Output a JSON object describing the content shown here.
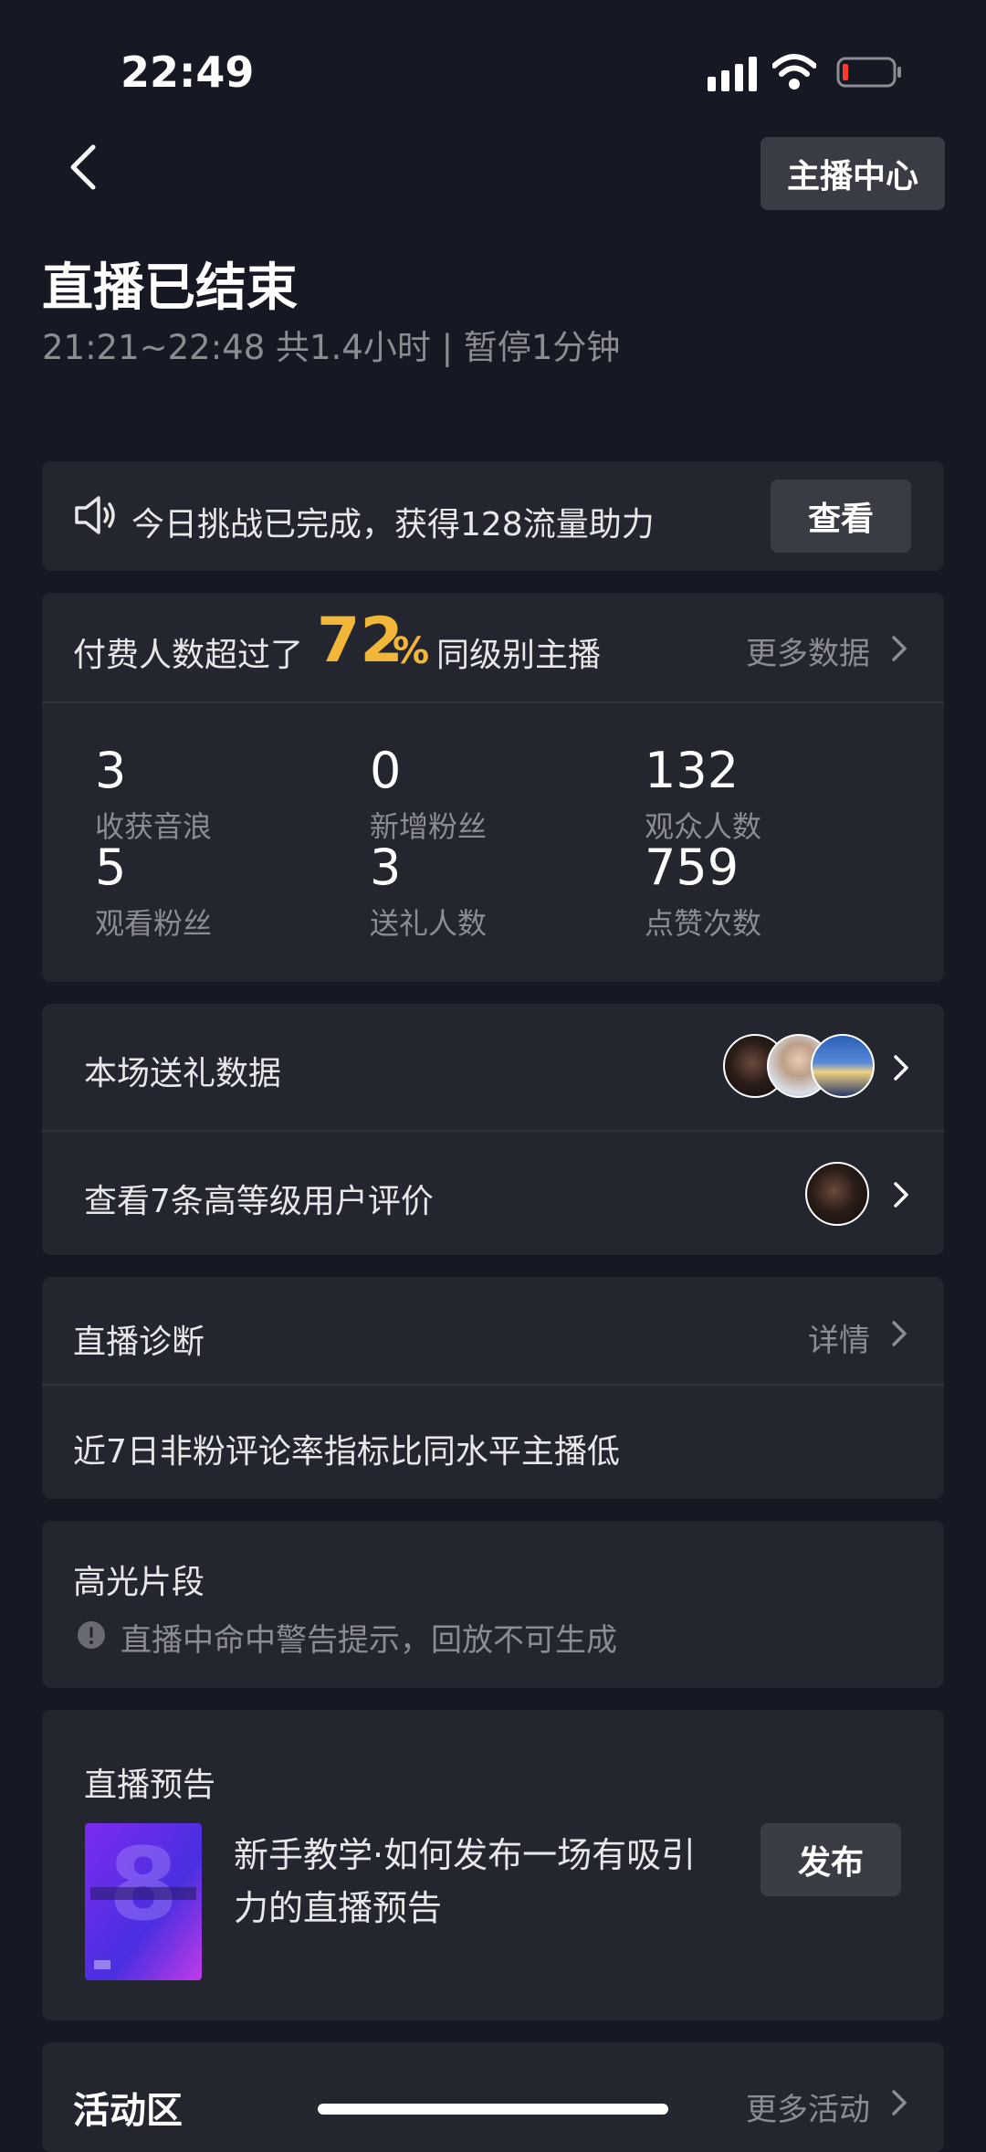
{
  "status_bar": {
    "time": "22:49"
  },
  "header": {
    "center_button": "主播中心",
    "title": "直播已结束",
    "subtitle": "21:21~22:48 共1.4小时 | 暂停1分钟"
  },
  "challenge": {
    "text": "今日挑战已完成，获得128流量助力",
    "button": "查看"
  },
  "paid": {
    "prefix": "付费人数超过了",
    "percent": "72",
    "percent_sign": "%",
    "suffix": "同级别主播",
    "more": "更多数据"
  },
  "stats": [
    {
      "value": "3",
      "label": "收获音浪"
    },
    {
      "value": "0",
      "label": "新增粉丝"
    },
    {
      "value": "132",
      "label": "观众人数"
    },
    {
      "value": "5",
      "label": "观看粉丝"
    },
    {
      "value": "3",
      "label": "送礼人数"
    },
    {
      "value": "759",
      "label": "点赞次数"
    }
  ],
  "gift": {
    "label": "本场送礼数据"
  },
  "reviews": {
    "label": "查看7条高等级用户评价"
  },
  "diagnosis": {
    "title": "直播诊断",
    "detail": "详情",
    "text": "近7日非粉评论率指标比同水平主播低"
  },
  "highlight": {
    "title": "高光片段",
    "warning": "直播中命中警告提示，回放不可生成"
  },
  "preview": {
    "title": "直播预告",
    "text": "新手教学·如何发布一场有吸引力的直播预告",
    "button": "发布"
  },
  "activity": {
    "title": "活动区",
    "more": "更多活动"
  },
  "colors": {
    "background": "#161823",
    "card": "#23252f",
    "accent": "#f2b739",
    "button": "#3a3c45"
  }
}
